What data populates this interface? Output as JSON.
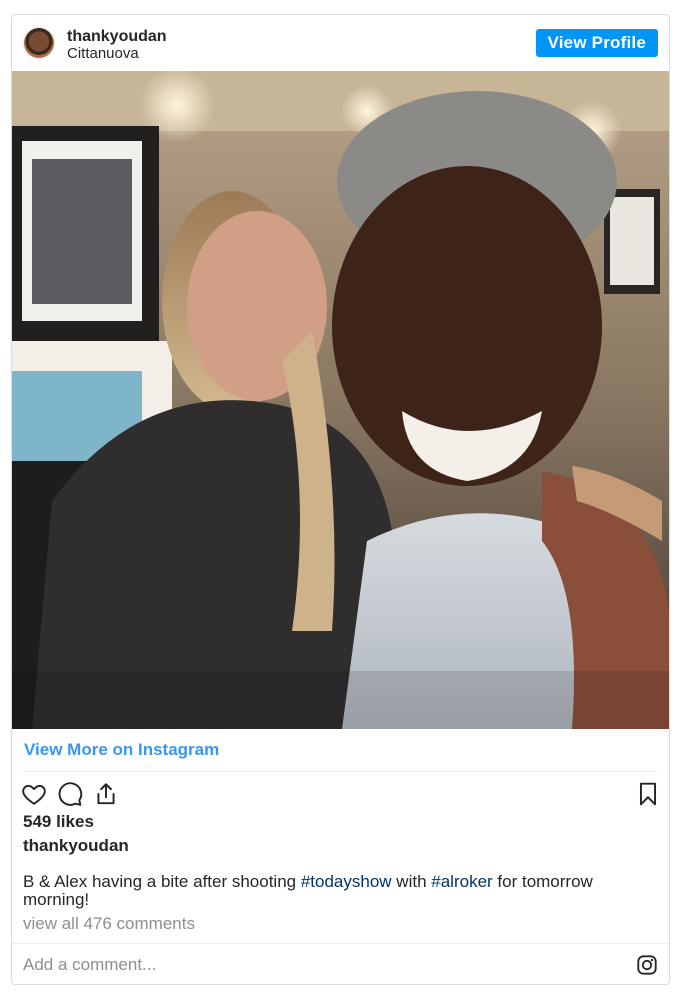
{
  "header": {
    "username": "thankyoudan",
    "location": "Cittanuova",
    "view_profile_label": "View Profile",
    "accent": "#0095f6"
  },
  "photo": {
    "alt": "Selfie of two women smiling in a restaurant"
  },
  "view_more_label": "View More on Instagram",
  "actions": {
    "icons": [
      "heart-icon",
      "comment-icon",
      "share-icon",
      "bookmark-icon"
    ]
  },
  "likes_text": "549 likes",
  "caption": {
    "username": "thankyoudan",
    "text_before": "B & Alex having a bite after shooting ",
    "hashtag1": "#todayshow",
    "text_middle": " with ",
    "hashtag2": "#alroker",
    "text_after": " for tomorrow morning!"
  },
  "comments_link": "view all 476 comments",
  "comment_box": {
    "placeholder": "Add a comment...",
    "icon": "instagram-icon"
  }
}
